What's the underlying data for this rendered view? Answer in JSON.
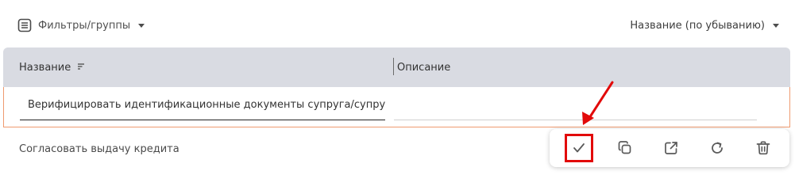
{
  "toolbar": {
    "filter_label": "Фильтры/группы",
    "filter_icon": "list-icon",
    "sort_label": "Название (по убыванию)"
  },
  "table": {
    "columns": [
      "Название",
      "Описание"
    ],
    "edit_row": {
      "name_value": "Верифицировать идентификационные документы супруга/супруги",
      "description_value": ""
    },
    "rows": [
      {
        "name": "Согласовать выдачу кредита",
        "description": ""
      }
    ]
  },
  "row_actions": {
    "items": [
      "check-icon",
      "copy-icon",
      "external-link-icon",
      "refresh-icon",
      "trash-icon"
    ],
    "highlighted": "check-icon"
  },
  "colors": {
    "header_bg": "#d9dbe2",
    "edit_border": "#ef9a6f",
    "highlight": "#e20a0a"
  }
}
